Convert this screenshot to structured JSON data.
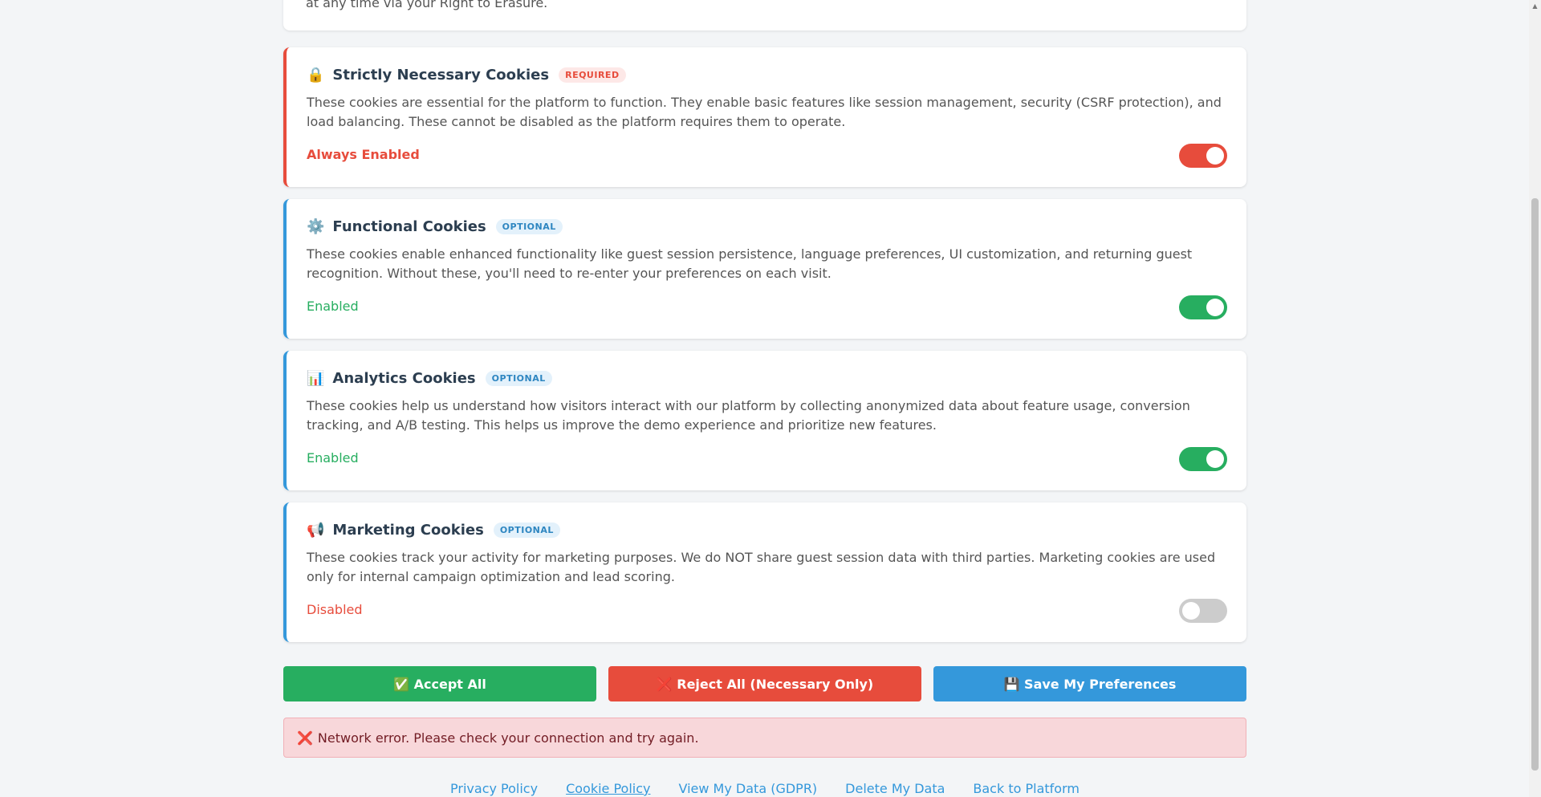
{
  "intro": {
    "cut_text": "at any time via your Right to Erasure."
  },
  "categories": [
    {
      "icon": "🔒",
      "icon_name": "lock-icon",
      "title": "Strictly Necessary Cookies",
      "badge": "REQUIRED",
      "description": "These cookies are essential for the platform to function. They enable basic features like session management, security (CSRF protection), and load balancing. These cannot be disabled as the platform requires them to operate.",
      "status": "Always Enabled",
      "enabled": true
    },
    {
      "icon": "⚙️",
      "icon_name": "gear-icon",
      "title": "Functional Cookies",
      "badge": "OPTIONAL",
      "description": "These cookies enable enhanced functionality like guest session persistence, language preferences, UI customization, and returning guest recognition. Without these, you'll need to re-enter your preferences on each visit.",
      "status": "Enabled",
      "enabled": true
    },
    {
      "icon": "📊",
      "icon_name": "bar-chart-icon",
      "title": "Analytics Cookies",
      "badge": "OPTIONAL",
      "description": "These cookies help us understand how visitors interact with our platform by collecting anonymized data about feature usage, conversion tracking, and A/B testing. This helps us improve the demo experience and prioritize new features.",
      "status": "Enabled",
      "enabled": true
    },
    {
      "icon": "📢",
      "icon_name": "megaphone-icon",
      "title": "Marketing Cookies",
      "badge": "OPTIONAL",
      "description": "These cookies track your activity for marketing purposes. We do NOT share guest session data with third parties. Marketing cookies are used only for internal campaign optimization and lead scoring.",
      "status": "Disabled",
      "enabled": false
    }
  ],
  "actions": {
    "accept_all": "✅ Accept All",
    "reject_all": "❌ Reject All (Necessary Only)",
    "save": "💾 Save My Preferences"
  },
  "error": {
    "icon": "❌",
    "message": "Network error. Please check your connection and try again."
  },
  "footer": {
    "links": [
      "Privacy Policy",
      "Cookie Policy",
      "View My Data (GDPR)",
      "Delete My Data",
      "Back to Platform"
    ]
  },
  "colors": {
    "required": "#e74c3c",
    "optional": "#3498db",
    "enabled": "#27ae60",
    "disabled_toggle": "#cccccc"
  }
}
